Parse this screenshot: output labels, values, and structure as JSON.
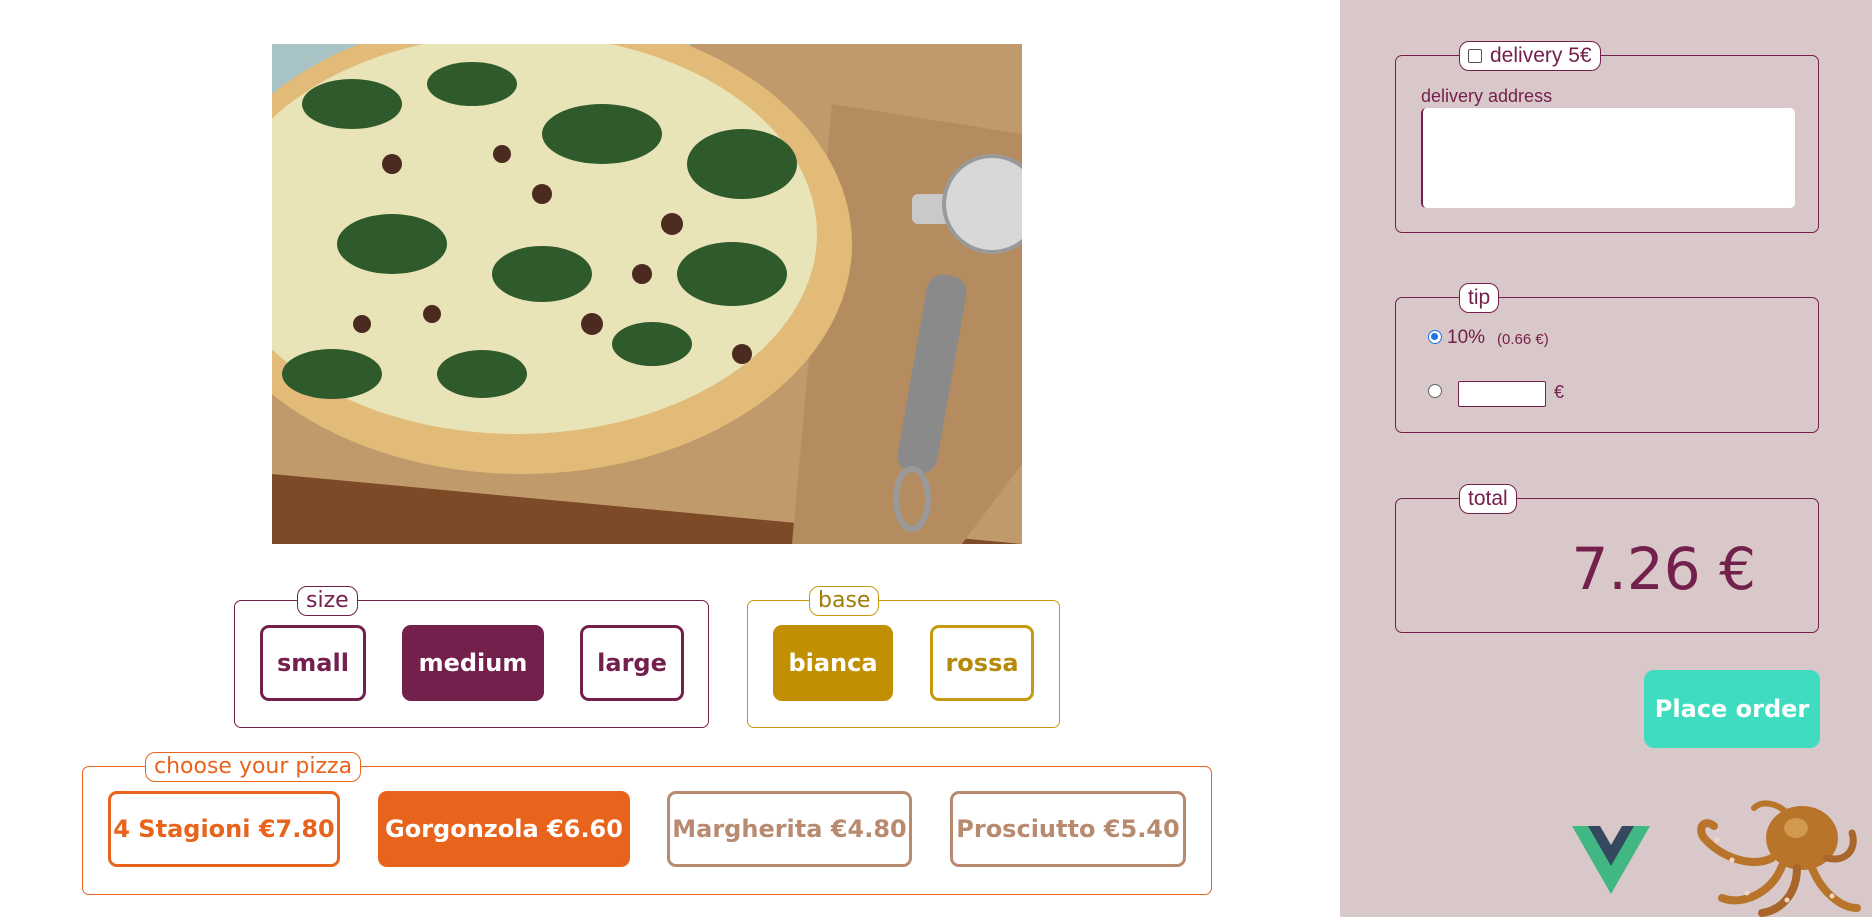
{
  "size": {
    "legend": "size",
    "options": [
      "small",
      "medium",
      "large"
    ],
    "selected": "medium"
  },
  "base": {
    "legend": "base",
    "options": [
      "bianca",
      "rossa"
    ],
    "selected": "bianca"
  },
  "pizza": {
    "legend": "choose your pizza",
    "options": [
      "4 Stagioni €7.80",
      "Gorgonzola €6.60",
      "Margherita €4.80",
      "Prosciutto €5.40"
    ],
    "selected": "Gorgonzola €6.60"
  },
  "delivery": {
    "legend": "delivery 5€",
    "checked": false,
    "address_label": "delivery address",
    "address_value": ""
  },
  "tip": {
    "legend": "tip",
    "percent_label": "10%",
    "percent_amount": "(0.66 €)",
    "custom_value": "",
    "currency": "€",
    "selected": "percent"
  },
  "total": {
    "legend": "total",
    "value": "7.26 €"
  },
  "order": {
    "button_label": "Place order"
  },
  "icons": {
    "photo": "pizza-photo",
    "vue": "vue-logo",
    "mascot": "octopus-illustration"
  },
  "colors": {
    "plum": "#74204d",
    "gold": "#c18f02",
    "orange": "#e8631b",
    "muted": "#b88a70",
    "teal": "#3fdcc0",
    "panel": "#d9c8c9"
  }
}
